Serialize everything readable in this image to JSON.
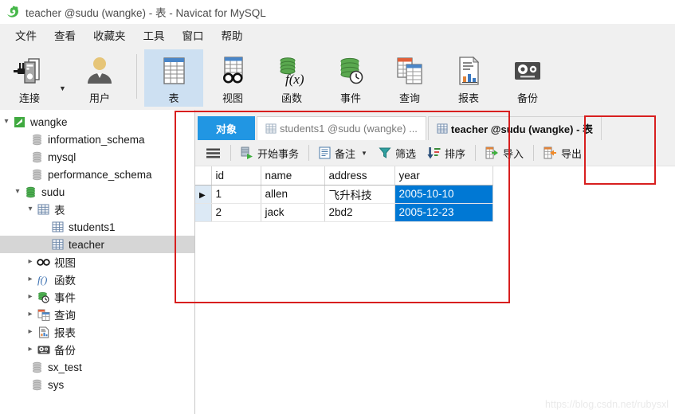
{
  "window": {
    "title": "teacher @sudu (wangke) - 表 - Navicat for MySQL",
    "logo_icon": "navicat-logo-icon"
  },
  "menubar": {
    "items": [
      {
        "label": "文件",
        "name": "menu-file"
      },
      {
        "label": "查看",
        "name": "menu-view"
      },
      {
        "label": "收藏夹",
        "name": "menu-favorites"
      },
      {
        "label": "工具",
        "name": "menu-tools"
      },
      {
        "label": "窗口",
        "name": "menu-window"
      },
      {
        "label": "帮助",
        "name": "menu-help"
      }
    ]
  },
  "ribbon": {
    "buttons": [
      {
        "label": "连接",
        "icon": "connection-icon",
        "active": false
      },
      {
        "label": "用户",
        "icon": "user-icon",
        "active": false
      },
      {
        "label": "表",
        "icon": "table-icon",
        "active": true
      },
      {
        "label": "视图",
        "icon": "view-icon",
        "active": false
      },
      {
        "label": "函数",
        "icon": "function-icon",
        "active": false
      },
      {
        "label": "事件",
        "icon": "event-icon",
        "active": false
      },
      {
        "label": "查询",
        "icon": "query-icon",
        "active": false
      },
      {
        "label": "报表",
        "icon": "report-icon",
        "active": false
      },
      {
        "label": "备份",
        "icon": "backup-icon",
        "active": false
      }
    ],
    "connection_dropdown_caret": "▼"
  },
  "sidebar": {
    "items": [
      {
        "label": "wangke",
        "icon": "connection-green-icon",
        "depth": 0,
        "expander": "expanded",
        "selected": false
      },
      {
        "label": "information_schema",
        "icon": "database-gray-icon",
        "depth": 1,
        "expander": "none",
        "selected": false
      },
      {
        "label": "mysql",
        "icon": "database-gray-icon",
        "depth": 1,
        "expander": "none",
        "selected": false
      },
      {
        "label": "performance_schema",
        "icon": "database-gray-icon",
        "depth": 1,
        "expander": "none",
        "selected": false
      },
      {
        "label": "sudu",
        "icon": "database-green-icon",
        "depth": 1,
        "expander": "expanded",
        "selected": false
      },
      {
        "label": "表",
        "icon": "table-folder-icon",
        "depth": 2,
        "expander": "expanded",
        "selected": false
      },
      {
        "label": "students1",
        "icon": "table-icon",
        "depth": 3,
        "expander": "none",
        "selected": false
      },
      {
        "label": "teacher",
        "icon": "table-icon",
        "depth": 3,
        "expander": "none",
        "selected": true
      },
      {
        "label": "视图",
        "icon": "view-icon",
        "depth": 2,
        "expander": "collapsed",
        "selected": false
      },
      {
        "label": "函数",
        "icon": "function-icon",
        "depth": 2,
        "expander": "collapsed",
        "selected": false
      },
      {
        "label": "事件",
        "icon": "event-icon",
        "depth": 2,
        "expander": "collapsed",
        "selected": false
      },
      {
        "label": "查询",
        "icon": "query-icon",
        "depth": 2,
        "expander": "collapsed",
        "selected": false
      },
      {
        "label": "报表",
        "icon": "report-icon",
        "depth": 2,
        "expander": "collapsed",
        "selected": false
      },
      {
        "label": "备份",
        "icon": "backup-icon",
        "depth": 2,
        "expander": "collapsed",
        "selected": false
      },
      {
        "label": "sx_test",
        "icon": "database-gray-icon",
        "depth": 1,
        "expander": "none",
        "selected": false
      },
      {
        "label": "sys",
        "icon": "database-gray-icon",
        "depth": 1,
        "expander": "none",
        "selected": false
      }
    ]
  },
  "tabs": [
    {
      "label": "对象",
      "icon": "none",
      "state": "object"
    },
    {
      "label": "students1 @sudu (wangke) ...",
      "icon": "table-icon",
      "state": "inactive"
    },
    {
      "label": "teacher @sudu (wangke) - 表",
      "icon": "table-icon",
      "state": "current"
    }
  ],
  "data_toolbar": {
    "buttons": [
      {
        "label": "",
        "icon": "hamburger-menu-icon",
        "name": "grid-menu-button",
        "caret": false
      },
      {
        "label": "开始事务",
        "icon": "begin-transaction-icon",
        "name": "begin-transaction-button",
        "caret": false
      },
      {
        "label": "备注",
        "icon": "note-icon",
        "name": "note-button",
        "caret": true
      },
      {
        "label": "筛选",
        "icon": "filter-icon",
        "name": "filter-button",
        "caret": false
      },
      {
        "label": "排序",
        "icon": "sort-icon",
        "name": "sort-button",
        "caret": false
      },
      {
        "label": "导入",
        "icon": "import-icon",
        "name": "import-button",
        "caret": false
      },
      {
        "label": "导出",
        "icon": "export-icon",
        "name": "export-button",
        "caret": false
      }
    ],
    "caret_glyph": "▼"
  },
  "grid": {
    "columns": [
      "id",
      "name",
      "address",
      "year"
    ],
    "rows": [
      {
        "current": true,
        "id": "1",
        "name": "allen",
        "address": "飞升科技",
        "year": "2005-10-10",
        "year_selected": true
      },
      {
        "current": false,
        "id": "2",
        "name": "jack",
        "address": "2bd2",
        "year": "2005-12-23",
        "year_selected": true
      }
    ],
    "row_marker_glyph": "▶"
  },
  "annotations": [
    {
      "name": "annotation-main-area",
      "color": "#d81f1f"
    },
    {
      "name": "annotation-export-button",
      "color": "#d81f1f"
    }
  ],
  "watermark": {
    "text": "https://blog.csdn.net/rubysxl"
  }
}
